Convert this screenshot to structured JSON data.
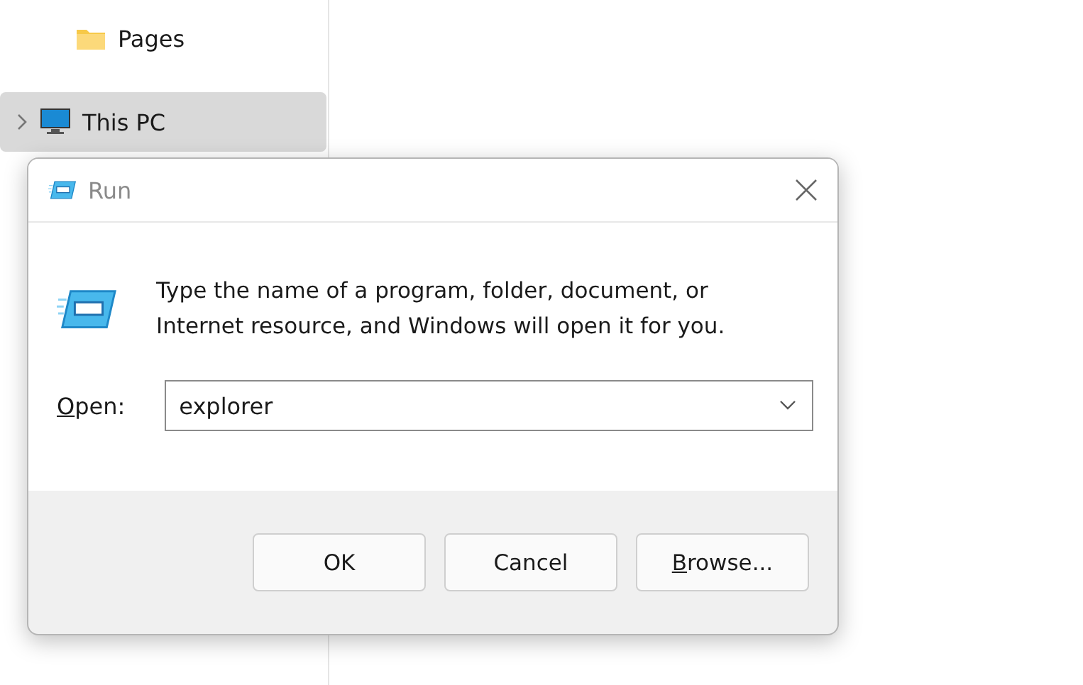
{
  "explorer": {
    "nav_items": [
      {
        "label": "Pages",
        "kind": "folder",
        "selected": false
      },
      {
        "label": "This PC",
        "kind": "computer",
        "selected": true
      }
    ]
  },
  "dialog": {
    "title": "Run",
    "description": "Type the name of a program, folder, document, or Internet resource, and Windows will open it for you.",
    "open_label": {
      "access_key": "O",
      "rest": "pen:"
    },
    "open_value": "explorer",
    "buttons": [
      {
        "label": "OK"
      },
      {
        "label": "Cancel"
      },
      {
        "access_key": "B",
        "label": "rowse..."
      }
    ]
  }
}
